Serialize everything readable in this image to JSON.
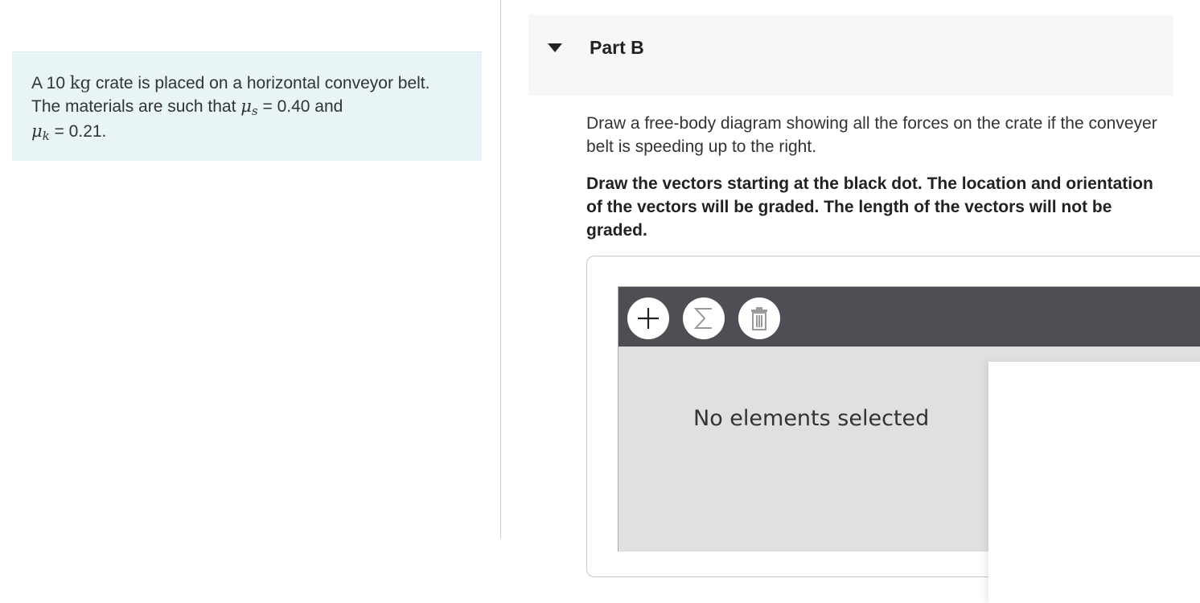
{
  "problem": {
    "text_a": "A 10 ",
    "unit_kg": "kg",
    "text_b": " crate is placed on a horizontal conveyor belt. The materials are such that ",
    "mu": "μ",
    "sub_s": "s",
    "eq_s": " = 0.40  and ",
    "sub_k": "k",
    "eq_k": " = 0.21."
  },
  "part": {
    "title": "Part B",
    "caret_icon": "caret-down-icon"
  },
  "instructions": {
    "prompt": "Draw a free-body diagram showing all the forces on the crate if the conveyer belt is speeding up to the right.",
    "bold": "Draw the vectors starting at the black dot. The location and orientation of the vectors will be graded. The length of the vectors will not be graded."
  },
  "toolbar": {
    "add_icon": "plus-icon",
    "sum_icon": "sigma-icon",
    "delete_icon": "trash-icon"
  },
  "canvas": {
    "status": "No elements selected"
  },
  "colors": {
    "problem_bg": "#e8f4f6",
    "header_bg": "#f7f7f7",
    "toolbar_bg": "#4e4f55",
    "canvas_bg": "#e0e0e0"
  }
}
